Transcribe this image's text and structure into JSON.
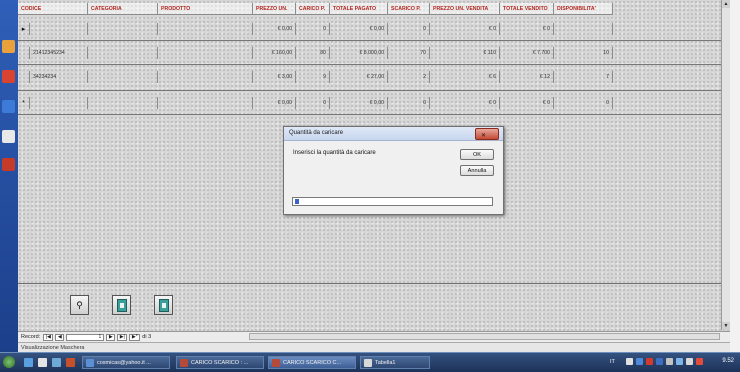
{
  "columns": [
    "CODICE",
    "CATEGORIA",
    "PRODOTTO",
    "PREZZO UN.",
    "CARICO P.",
    "TOTALE PAGATO",
    "SCARICO P.",
    "PREZZO UN. VENDITA",
    "TOTALE VENDITO",
    "DISPONIBILITA'"
  ],
  "rows": [
    {
      "selector": "▸",
      "cells": [
        "",
        "",
        "",
        "€ 0,00",
        "0",
        "€ 0,00",
        "0",
        "€ 0",
        "€ 0",
        ""
      ]
    },
    {
      "selector": "",
      "cells": [
        "21412345234",
        "",
        "",
        "€ 160,00",
        "80",
        "€ 8.000,00",
        "70",
        "€ 110",
        "€ 7.700",
        "10"
      ]
    },
    {
      "selector": "",
      "cells": [
        "34234234",
        "",
        "",
        "€ 3,00",
        "9",
        "€ 27,00",
        "2",
        "€ 6",
        "€ 12",
        "7"
      ]
    },
    {
      "selector": "*",
      "cells": [
        "",
        "",
        "",
        "€ 0,00",
        "0",
        "€ 0,00",
        "0",
        "€ 0",
        "€ 0",
        "0"
      ]
    }
  ],
  "dialog": {
    "title": "Quantità da caricare",
    "close_glyph": "✕",
    "prompt": "Inserisci la quantità da caricare",
    "ok_label": "OK",
    "cancel_label": "Annulla",
    "input_value": ""
  },
  "navigation": {
    "record_label": "Record:",
    "first": "|◀",
    "prev": "◀",
    "current": "1",
    "next": "▶",
    "last": "▶|",
    "new": "▶*",
    "total": "di 3"
  },
  "status_text": "Visualizzazione Maschera",
  "taskbar": {
    "tasks": [
      "cosmicas@yahoo.it ...",
      "CARICO SCARICO : ...",
      "CARICO SCARICO C...",
      "Tabella1"
    ],
    "tray_label": "IT",
    "clock": "9.52"
  },
  "colors": {
    "header_text": "#b3261e",
    "taskbar": "#1d3257",
    "dialog_close": "#c44a34"
  }
}
